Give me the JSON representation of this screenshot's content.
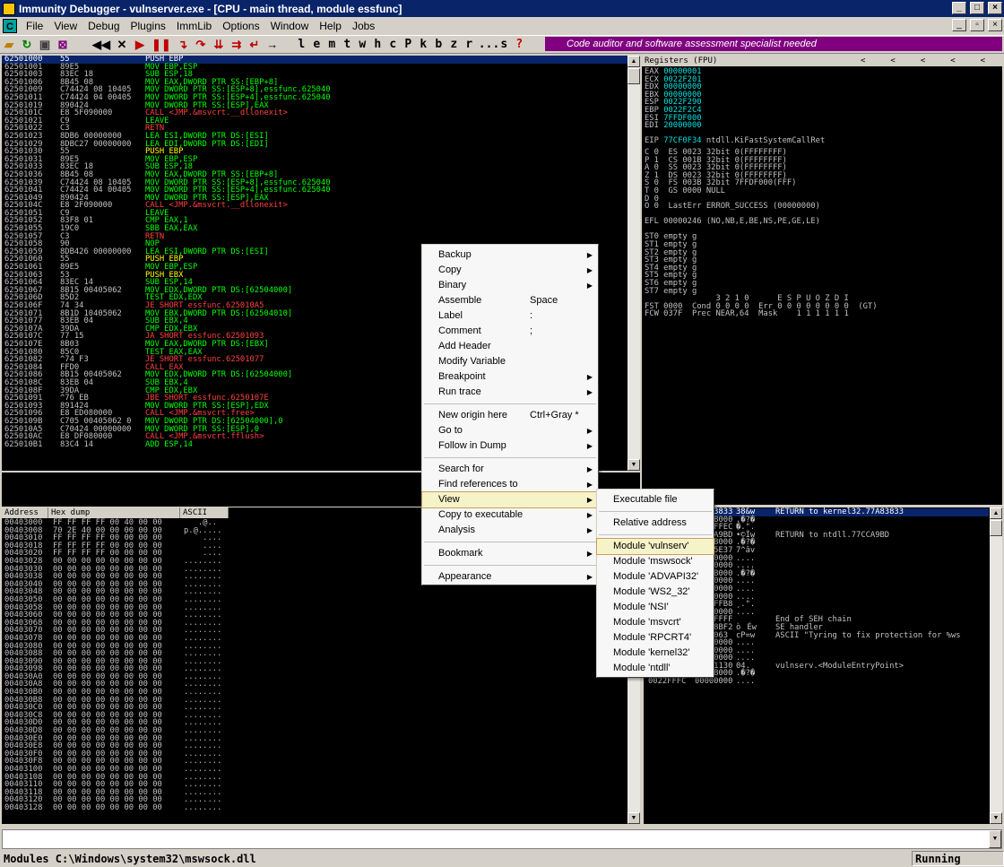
{
  "window": {
    "title": "Immunity Debugger - vulnserver.exe - [CPU - main thread, module essfunc]"
  },
  "menu": [
    "File",
    "View",
    "Debug",
    "Plugins",
    "ImmLib",
    "Options",
    "Window",
    "Help",
    "Jobs"
  ],
  "toolbar": {
    "letters": [
      "l",
      "e",
      "m",
      "t",
      "w",
      "h",
      "c",
      "P",
      "k",
      "b",
      "z",
      "r",
      "...",
      "s",
      "?"
    ],
    "banner": "Code auditor and software assessment specialist needed"
  },
  "disasm": [
    [
      "62501000",
      "55",
      "PUSH EBP",
      ""
    ],
    [
      "62501001",
      "89E5",
      "MOV EBP,ESP",
      ""
    ],
    [
      "62501003",
      "83EC 18",
      "SUB ESP,18",
      ""
    ],
    [
      "62501006",
      "8B45 08",
      "MOV EAX,DWORD PTR SS:[EBP+8]",
      ""
    ],
    [
      "62501009",
      "C74424 08 10405",
      "MOV DWORD PTR SS:[ESP+8],essfunc.625040",
      ""
    ],
    [
      "62501011",
      "C74424 04 00405",
      "MOV DWORD PTR SS:[ESP+4],essfunc.625040",
      ""
    ],
    [
      "62501019",
      "890424",
      "MOV DWORD PTR SS:[ESP],EAX",
      ""
    ],
    [
      "6250101C",
      "E8 5F090000",
      "CALL <JMP.&msvcrt.__dllonexit>",
      ""
    ],
    [
      "62501021",
      "C9",
      "LEAVE",
      ""
    ],
    [
      "62501022",
      "C3",
      "RETN",
      ""
    ],
    [
      "62501023",
      "8DB6 00000000",
      "LEA ESI,DWORD PTR DS:[ESI]",
      ""
    ],
    [
      "62501029",
      "8DBC27 00000000",
      "LEA EDI,DWORD PTR DS:[EDI]",
      ""
    ],
    [
      "62501030",
      "55",
      "PUSH EBP",
      ""
    ],
    [
      "62501031",
      "89E5",
      "MOV EBP,ESP",
      ""
    ],
    [
      "62501033",
      "83EC 18",
      "SUB ESP,18",
      ""
    ],
    [
      "62501036",
      "8B45 08",
      "MOV EAX,DWORD PTR SS:[EBP+8]",
      ""
    ],
    [
      "62501039",
      "C74424 08 10405",
      "MOV DWORD PTR SS:[ESP+8],essfunc.625040",
      ""
    ],
    [
      "62501041",
      "C74424 04 00405",
      "MOV DWORD PTR SS:[ESP+4],essfunc.625040",
      ""
    ],
    [
      "62501049",
      "890424",
      "MOV DWORD PTR SS:[ESP],EAX",
      ""
    ],
    [
      "6250104C",
      "E8 2F090000",
      "CALL <JMP.&msvcrt.__dllonexit>",
      ""
    ],
    [
      "62501051",
      "C9",
      "LEAVE",
      ""
    ],
    [
      "62501052",
      "83F8 01",
      "CMP EAX,1",
      ""
    ],
    [
      "62501055",
      "19C0",
      "SBB EAX,EAX",
      ""
    ],
    [
      "62501057",
      "C3",
      "RETN",
      ""
    ],
    [
      "62501058",
      "90",
      "NOP",
      ""
    ],
    [
      "62501059",
      "8DB426 00000000",
      "LEA ESI,DWORD PTR DS:[ESI]",
      ""
    ],
    [
      "62501060",
      "55",
      "PUSH EBP",
      ""
    ],
    [
      "62501061",
      "89E5",
      "MOV EBP,ESP",
      ""
    ],
    [
      "62501063",
      "53",
      "PUSH EBX",
      ""
    ],
    [
      "62501064",
      "83EC 14",
      "SUB ESP,14",
      ""
    ],
    [
      "62501067",
      "8B15 00405062",
      "MOV EDX,DWORD PTR DS:[62504000]",
      ""
    ],
    [
      "6250106D",
      "85D2",
      "TEST EDX,EDX",
      ""
    ],
    [
      "6250106F",
      "74 34",
      "JE SHORT essfunc.625010A5",
      ""
    ],
    [
      "62501071",
      "8B1D 10405062",
      "MOV EBX,DWORD PTR DS:[62504010]",
      ""
    ],
    [
      "62501077",
      "83EB 04",
      "SUB EBX,4",
      ""
    ],
    [
      "6250107A",
      "39DA",
      "CMP EDX,EBX",
      ""
    ],
    [
      "6250107C",
      "77 15",
      "JA SHORT essfunc.62501093",
      ""
    ],
    [
      "6250107E",
      "8B03",
      "MOV EAX,DWORD PTR DS:[EBX]",
      ""
    ],
    [
      "62501080",
      "85C0",
      "TEST EAX,EAX",
      ""
    ],
    [
      "62501082",
      "^74 F3",
      "JE SHORT essfunc.62501077",
      ""
    ],
    [
      "62501084",
      "FFD0",
      "CALL EAX",
      ""
    ],
    [
      "62501086",
      "8B15 00405062",
      "MOV EDX,DWORD PTR DS:[62504000]",
      ""
    ],
    [
      "6250108C",
      "83EB 04",
      "SUB EBX,4",
      ""
    ],
    [
      "6250108F",
      "39DA",
      "CMP EDX,EBX",
      ""
    ],
    [
      "62501091",
      "^76 EB",
      "JBE SHORT essfunc.6250107E",
      ""
    ],
    [
      "62501093",
      "891424",
      "MOV DWORD PTR SS:[ESP],EDX",
      ""
    ],
    [
      "62501096",
      "E8 ED080000",
      "CALL <JMP.&msvcrt.free>",
      ""
    ],
    [
      "6250109B",
      "C705 00405062 0",
      "MOV DWORD PTR DS:[62504000],0",
      ""
    ],
    [
      "625010A5",
      "C70424 00000000",
      "MOV DWORD PTR SS:[ESP],0",
      ""
    ],
    [
      "625010AC",
      "E8 DF080000",
      "CALL <JMP.&msvcrt.fflush>",
      ""
    ],
    [
      "625010B1",
      "83C4 14",
      "ADD ESP,14",
      ""
    ]
  ],
  "registers": {
    "header": "Registers (FPU)",
    "lines": [
      [
        "EAX",
        "00000001",
        ""
      ],
      [
        "ECX",
        "0022F201",
        ""
      ],
      [
        "EDX",
        "00000000",
        ""
      ],
      [
        "EBX",
        "00000000",
        ""
      ],
      [
        "ESP",
        "0022F290",
        ""
      ],
      [
        "EBP",
        "0022F2C4",
        ""
      ],
      [
        "ESI",
        "7FFDF000",
        ""
      ],
      [
        "EDI",
        "20000000",
        ""
      ],
      [
        "",
        "",
        " "
      ],
      [
        "EIP",
        "77CF0F34",
        "ntdll.KiFastSystemCallRet"
      ]
    ],
    "flags": [
      "C 0  ES 0023 32bit 0(FFFFFFFF)",
      "P 1  CS 001B 32bit 0(FFFFFFFF)",
      "A 0  SS 0023 32bit 0(FFFFFFFF)",
      "Z 1  DS 0023 32bit 0(FFFFFFFF)",
      "S 0  FS 003B 32bit 7FFDF000(FFF)",
      "T 0  GS 0000 NULL",
      "D 0",
      "O 0  LastErr ERROR_SUCCESS (00000000)",
      " ",
      "EFL 00000246 (NO,NB,E,BE,NS,PE,GE,LE)",
      " ",
      "ST0 empty g",
      "ST1 empty g",
      "ST2 empty g",
      "ST3 empty g",
      "ST4 empty g",
      "ST5 empty g",
      "ST6 empty g",
      "ST7 empty g",
      "               3 2 1 0      E S P U O Z D I",
      "FST 0000  Cond 0 0 0 0  Err 0 0 0 0 0 0 0 0  (GT)",
      "FCW 037F  Prec NEAR,64  Mask    1 1 1 1 1 1"
    ]
  },
  "dump": {
    "headers": [
      "Address",
      "Hex dump",
      "ASCII"
    ],
    "rows": [
      [
        "00403000",
        "FF FF FF FF 00 40 00 00",
        "   .@.."
      ],
      [
        "00403008",
        "70 2E 40 00 00 00 00 00",
        "p.@....."
      ],
      [
        "00403010",
        "FF FF FF FF 00 00 00 00",
        "    ...."
      ],
      [
        "00403018",
        "FF FF FF FF 00 00 00 00",
        "    ...."
      ],
      [
        "00403020",
        "FF FF FF FF 00 00 00 00",
        "    ...."
      ],
      [
        "00403028",
        "00 00 00 00 00 00 00 00",
        "........"
      ],
      [
        "00403030",
        "00 00 00 00 00 00 00 00",
        "........"
      ],
      [
        "00403038",
        "00 00 00 00 00 00 00 00",
        "........"
      ],
      [
        "00403040",
        "00 00 00 00 00 00 00 00",
        "........"
      ],
      [
        "00403048",
        "00 00 00 00 00 00 00 00",
        "........"
      ],
      [
        "00403050",
        "00 00 00 00 00 00 00 00",
        "........"
      ],
      [
        "00403058",
        "00 00 00 00 00 00 00 00",
        "........"
      ],
      [
        "00403060",
        "00 00 00 00 00 00 00 00",
        "........"
      ],
      [
        "00403068",
        "00 00 00 00 00 00 00 00",
        "........"
      ],
      [
        "00403070",
        "00 00 00 00 00 00 00 00",
        "........"
      ],
      [
        "00403078",
        "00 00 00 00 00 00 00 00",
        "........"
      ],
      [
        "00403080",
        "00 00 00 00 00 00 00 00",
        "........"
      ],
      [
        "00403088",
        "00 00 00 00 00 00 00 00",
        "........"
      ],
      [
        "00403090",
        "00 00 00 00 00 00 00 00",
        "........"
      ],
      [
        "00403098",
        "00 00 00 00 00 00 00 00",
        "........"
      ],
      [
        "004030A0",
        "00 00 00 00 00 00 00 00",
        "........"
      ],
      [
        "004030A8",
        "00 00 00 00 00 00 00 00",
        "........"
      ],
      [
        "004030B0",
        "00 00 00 00 00 00 00 00",
        "........"
      ],
      [
        "004030B8",
        "00 00 00 00 00 00 00 00",
        "........"
      ],
      [
        "004030C0",
        "00 00 00 00 00 00 00 00",
        "........"
      ],
      [
        "004030C8",
        "00 00 00 00 00 00 00 00",
        "........"
      ],
      [
        "004030D0",
        "00 00 00 00 00 00 00 00",
        "........"
      ],
      [
        "004030D8",
        "00 00 00 00 00 00 00 00",
        "........"
      ],
      [
        "004030E0",
        "00 00 00 00 00 00 00 00",
        "........"
      ],
      [
        "004030E8",
        "00 00 00 00 00 00 00 00",
        "........"
      ],
      [
        "004030F0",
        "00 00 00 00 00 00 00 00",
        "........"
      ],
      [
        "004030F8",
        "00 00 00 00 00 00 00 00",
        "........"
      ],
      [
        "00403100",
        "00 00 00 00 00 00 00 00",
        "........"
      ],
      [
        "00403108",
        "00 00 00 00 00 00 00 00",
        "........"
      ],
      [
        "00403110",
        "00 00 00 00 00 00 00 00",
        "........"
      ],
      [
        "00403118",
        "00 00 00 00 00 00 00 00",
        "........"
      ],
      [
        "00403120",
        "00 00 00 00 00 00 00 00",
        "........"
      ],
      [
        "00403128",
        "00 00 00 00 00 00 00 00",
        "........"
      ]
    ]
  },
  "stack": [
    [
      "0022FF?? ",
      "77A83833",
      "38&w",
      "RETURN to kernel32.77A83833"
    ],
    [
      "",
      "7FFDB000",
      ".�?�",
      ""
    ],
    [
      "",
      "0022FFEC",
      "�.\".",
      ""
    ],
    [
      "",
      "77CCA9BD",
      "•©Ìw",
      "RETURN to ntdll.77CCA9BD"
    ],
    [
      "",
      "7FFDB000",
      ".�?�",
      ""
    ],
    [
      "",
      "76E25E37",
      "7^âv",
      ""
    ],
    [
      "",
      "00000000",
      "....",
      ""
    ],
    [
      "",
      "00000000",
      "....",
      ""
    ],
    [
      "",
      "7FFDB000",
      ".�?�",
      ""
    ],
    [
      "",
      "00000000",
      "....",
      ""
    ],
    [
      "",
      "00000000",
      "....",
      ""
    ],
    [
      "",
      "00000000",
      "....",
      ""
    ],
    [
      "",
      "0022FFB8",
      "¸.\".",
      ""
    ],
    [
      "",
      "00000000",
      "....",
      ""
    ],
    [
      "",
      "FFFFFFFF",
      "",
      "End of SEH chain"
    ],
    [
      "",
      "77C98BF2",
      "òÉw",
      "SE handler"
    ],
    [
      "",
      "04C5063",
      "cP=w",
      "ASCII \"Tyring to fix protection for %ws"
    ],
    [
      "",
      "00000000",
      "....",
      ""
    ],
    [
      "",
      "00000000",
      "....",
      ""
    ],
    [
      "",
      "00000000",
      "....",
      ""
    ],
    [
      "",
      "00401130",
      "0\u00114.",
      "vulnserv.<ModuleEntryPoint>"
    ],
    [
      "0022FFF8",
      "7FFDB000",
      ".�?�",
      ""
    ],
    [
      "0022FFFC",
      "00000000",
      "....",
      ""
    ]
  ],
  "context_menu": [
    {
      "label": "Backup",
      "sub": true
    },
    {
      "label": "Copy",
      "sub": true
    },
    {
      "label": "Binary",
      "sub": true
    },
    {
      "label": "Assemble",
      "shortcut": "Space"
    },
    {
      "label": "Label",
      "shortcut": ":"
    },
    {
      "label": "Comment",
      "shortcut": ";"
    },
    {
      "label": "Add Header"
    },
    {
      "label": "Modify Variable"
    },
    {
      "label": "Breakpoint",
      "sub": true
    },
    {
      "label": "Run trace",
      "sub": true
    },
    {
      "sep": true
    },
    {
      "label": "New origin here",
      "shortcut": "Ctrl+Gray *"
    },
    {
      "label": "Go to",
      "sub": true
    },
    {
      "label": "Follow in Dump",
      "sub": true
    },
    {
      "sep": true
    },
    {
      "label": "Search for",
      "sub": true
    },
    {
      "label": "Find references to",
      "sub": true
    },
    {
      "label": "View",
      "sub": true,
      "hl": true
    },
    {
      "label": "Copy to executable",
      "sub": true
    },
    {
      "label": "Analysis",
      "sub": true
    },
    {
      "sep": true
    },
    {
      "label": "Bookmark",
      "sub": true
    },
    {
      "sep": true
    },
    {
      "label": "Appearance",
      "sub": true
    }
  ],
  "submenu": [
    {
      "label": "Executable file"
    },
    {
      "sep": true
    },
    {
      "label": "Relative address"
    },
    {
      "sep": true
    },
    {
      "label": "Module 'vulnserv'",
      "hl": true
    },
    {
      "label": "Module 'mswsock'"
    },
    {
      "label": "Module 'ADVAPI32'"
    },
    {
      "label": "Module 'WS2_32'"
    },
    {
      "label": "Module 'NSI'"
    },
    {
      "label": "Module 'msvcrt'"
    },
    {
      "label": "Module 'RPCRT4'"
    },
    {
      "label": "Module 'kernel32'"
    },
    {
      "label": "Module 'ntdll'"
    }
  ],
  "status": {
    "text": "Modules C:\\Windows\\system32\\mswsock.dll",
    "state": "Running"
  }
}
